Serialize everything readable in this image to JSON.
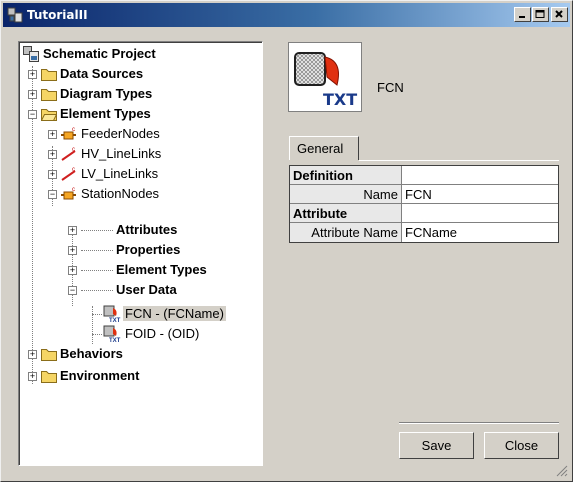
{
  "window": {
    "title": "TutorialII"
  },
  "tree": {
    "root": "Schematic Project",
    "items": [
      {
        "label": "Data Sources"
      },
      {
        "label": "Diagram Types"
      },
      {
        "label": "Element Types"
      },
      {
        "label": "FeederNodes"
      },
      {
        "label": "HV_LineLinks"
      },
      {
        "label": "LV_LineLinks"
      },
      {
        "label": "StationNodes"
      },
      {
        "label": "Attributes"
      },
      {
        "label": "Properties"
      },
      {
        "label": "Element Types"
      },
      {
        "label": "User Data"
      },
      {
        "label": "FCN - (FCName)"
      },
      {
        "label": "FOID - (OID)"
      },
      {
        "label": "Behaviors"
      },
      {
        "label": "Environment"
      }
    ]
  },
  "detail": {
    "name": "FCN",
    "icon_text": "TXT",
    "tab": "General",
    "table": {
      "rows": [
        {
          "key": "Definition",
          "value": ""
        },
        {
          "key": "Name",
          "value": "FCN"
        },
        {
          "key": "Attribute",
          "value": ""
        },
        {
          "key": "Attribute Name",
          "value": "FCName"
        }
      ]
    }
  },
  "buttons": {
    "save": "Save",
    "close": "Close"
  },
  "colors": {
    "titlebar_start": "#0a246a",
    "titlebar_end": "#a6caf0",
    "folder": "#f5d565",
    "face": "#d4d0c8"
  }
}
